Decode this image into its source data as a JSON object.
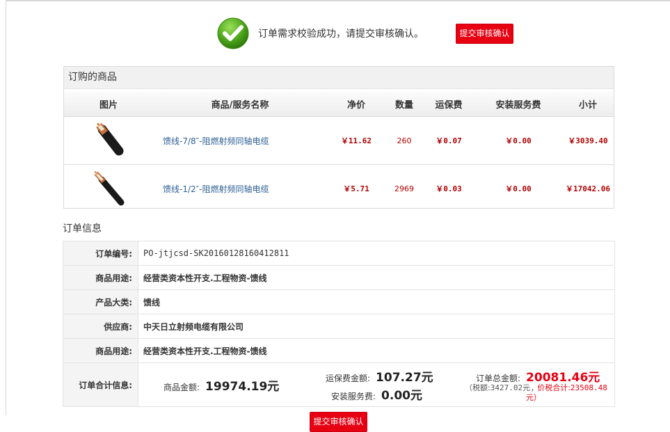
{
  "success": {
    "message": "订单需求校验成功，请提交审核确认。",
    "submit_button": "提交审核确认"
  },
  "goods": {
    "title": "订购的商品",
    "columns": [
      "图片",
      "商品/服务名称",
      "净价",
      "数量",
      "运保费",
      "安装服务费",
      "小计"
    ],
    "rows": [
      {
        "image": "cable-7-8-icon",
        "name": "馈线-7/8″-阻燃射频同轴电缆",
        "net_price": "￥11.62",
        "quantity": "260",
        "shipping": "￥0.07",
        "install": "￥0.00",
        "subtotal": "￥3039.40"
      },
      {
        "image": "cable-1-2-icon",
        "name": "馈线-1/2″-阻燃射频同轴电缆",
        "net_price": "￥5.71",
        "quantity": "2969",
        "shipping": "￥0.03",
        "install": "￥0.00",
        "subtotal": "￥17042.06"
      }
    ]
  },
  "order_info": {
    "title": "订单信息",
    "order_no_label": "订单编号:",
    "order_no": "PO-jtjcsd-SK20160128160412811",
    "usage_label": "商品用途:",
    "usage": "经营类资本性开支.工程物资-馈线",
    "category_label": "产品大类:",
    "category": "馈线",
    "supplier_label": "供应商:",
    "supplier": "中天日立射频电缆有限公司",
    "usage2_label": "商品用途:",
    "usage2": "经营类资本性开支.工程物资-馈线",
    "total_label": "订单合计信息:",
    "goods_amount_label": "商品金额:",
    "goods_amount": "19974.19元",
    "shipping_amount_label": "运保费金额:",
    "shipping_amount": "107.27元",
    "install_fee_label": "安装服务费:",
    "install_fee": "0.00元",
    "order_total_label": "订单总金额:",
    "order_total": "20081.46元",
    "tax_prefix": "（税额:",
    "tax_value": "3427.02元,",
    "tax_total_label": "价税合计:",
    "tax_total_value": "23508.48",
    "tax_suffix": "元）"
  },
  "colors": {
    "accent_red": "#e60012",
    "link_blue": "#2c5f95",
    "success_green": "#5aab1f"
  }
}
